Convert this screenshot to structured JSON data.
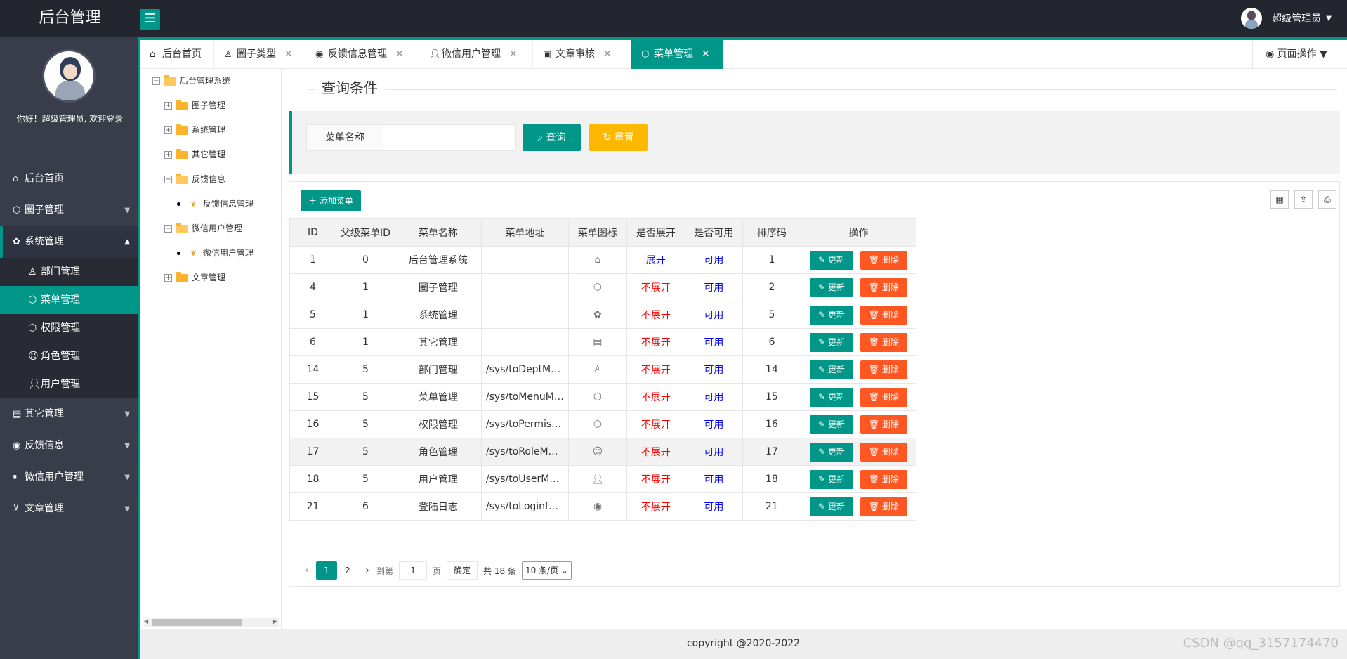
{
  "header": {
    "logo": "后台管理",
    "menu_toggle_icon": "hamburger-icon",
    "user_name": "超级管理员"
  },
  "sidebar": {
    "welcome": "你好！超级管理员, 欢迎登录",
    "items": [
      {
        "label": "后台首页",
        "icon": "home-icon"
      },
      {
        "label": "圈子管理",
        "icon": "cube-icon"
      },
      {
        "label": "系统管理",
        "icon": "gear-icon"
      },
      {
        "label": "其它管理",
        "icon": "clipboard-icon"
      },
      {
        "label": "反馈信息",
        "icon": "weibo-icon"
      },
      {
        "label": "微信用户管理",
        "icon": "pause-circle-icon"
      },
      {
        "label": "文章管理",
        "icon": "cart-icon"
      }
    ],
    "sub_items": [
      {
        "label": "部门管理",
        "icon": "user-outline-icon"
      },
      {
        "label": "菜单管理",
        "icon": "cube-icon"
      },
      {
        "label": "权限管理",
        "icon": "cube-icon"
      },
      {
        "label": "角色管理",
        "icon": "smile-icon"
      },
      {
        "label": "用户管理",
        "icon": "user-icon"
      }
    ]
  },
  "tabs": [
    {
      "label": "后台首页",
      "icon": "home-icon"
    },
    {
      "label": "圈子类型",
      "icon": "user-outline-icon"
    },
    {
      "label": "反馈信息管理",
      "icon": "weibo-icon"
    },
    {
      "label": "微信用户管理",
      "icon": "user-icon"
    },
    {
      "label": "文章审核",
      "icon": "image-icon"
    },
    {
      "label": "菜单管理",
      "icon": "cube-icon"
    }
  ],
  "page_op": "页面操作",
  "tree": {
    "root": "后台管理系统",
    "nodes": [
      "圈子管理",
      "系统管理",
      "其它管理",
      "反馈信息",
      "反馈信息管理",
      "微信用户管理",
      "微信用户管理",
      "文章管理"
    ]
  },
  "query": {
    "legend": "查询条件",
    "label": "菜单名称",
    "value": "",
    "search_btn": "查询",
    "reset_btn": "重置"
  },
  "table": {
    "add_btn": "添加菜单",
    "headers": [
      "ID",
      "父级菜单ID",
      "菜单名称",
      "菜单地址",
      "菜单图标",
      "是否展开",
      "是否可用",
      "排序码",
      "操作"
    ],
    "edit_label": "更新",
    "delete_label": "删除",
    "rows": [
      {
        "id": "1",
        "pid": "0",
        "name": "后台管理系统",
        "url": "",
        "icon": "home-icon",
        "spread": "展开",
        "available": "可用",
        "sort": "1"
      },
      {
        "id": "4",
        "pid": "1",
        "name": "圈子管理",
        "url": "",
        "icon": "cube-icon",
        "spread": "不展开",
        "available": "可用",
        "sort": "2"
      },
      {
        "id": "5",
        "pid": "1",
        "name": "系统管理",
        "url": "",
        "icon": "gear-icon",
        "spread": "不展开",
        "available": "可用",
        "sort": "5"
      },
      {
        "id": "6",
        "pid": "1",
        "name": "其它管理",
        "url": "",
        "icon": "clipboard-icon",
        "spread": "不展开",
        "available": "可用",
        "sort": "6"
      },
      {
        "id": "14",
        "pid": "5",
        "name": "部门管理",
        "url": "/sys/toDeptMana...",
        "icon": "user-outline-icon",
        "spread": "不展开",
        "available": "可用",
        "sort": "14"
      },
      {
        "id": "15",
        "pid": "5",
        "name": "菜单管理",
        "url": "/sys/toMenuMan...",
        "icon": "cube-icon",
        "spread": "不展开",
        "available": "可用",
        "sort": "15"
      },
      {
        "id": "16",
        "pid": "5",
        "name": "权限管理",
        "url": "/sys/toPermissio...",
        "icon": "cube-icon",
        "spread": "不展开",
        "available": "可用",
        "sort": "16"
      },
      {
        "id": "17",
        "pid": "5",
        "name": "角色管理",
        "url": "/sys/toRoleMana...",
        "icon": "smile-icon",
        "spread": "不展开",
        "available": "可用",
        "sort": "17"
      },
      {
        "id": "18",
        "pid": "5",
        "name": "用户管理",
        "url": "/sys/toUserMana...",
        "icon": "user-icon",
        "spread": "不展开",
        "available": "可用",
        "sort": "18"
      },
      {
        "id": "21",
        "pid": "6",
        "name": "登陆日志",
        "url": "/sys/toLoginfoMa...",
        "icon": "weibo-icon",
        "spread": "不展开",
        "available": "可用",
        "sort": "21"
      }
    ]
  },
  "pager": {
    "page1": "1",
    "page2": "2",
    "goto": "到第",
    "page_input": "1",
    "page_unit": "页",
    "confirm": "确定",
    "total": "共 18 条",
    "per_page": "10 条/页"
  },
  "footer": "copyright @2020-2022",
  "watermark": "CSDN @qq_3157174470",
  "colors": {
    "primary": "#009688",
    "danger": "#ff5722",
    "warning": "#ffb800",
    "dark": "#23262e"
  }
}
